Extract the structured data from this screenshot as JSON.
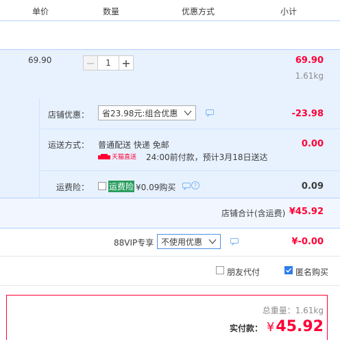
{
  "header": {
    "unit_price": "单价",
    "quantity": "数量",
    "discount_method": "优惠方式",
    "subtotal": "小计"
  },
  "item": {
    "unit_price": "69.90",
    "quantity": "1",
    "minus": "−",
    "plus": "+",
    "subtotal": "69.90",
    "weight": "1.61kg"
  },
  "shop": {
    "discount_label": "店铺优惠：",
    "discount_select": "省23.98元:组合优惠",
    "discount_amount": "-23.98",
    "shipping_label": "运送方式：",
    "shipping_method": "普通配送 快递 免邮",
    "tmall_direct": "天猫直送",
    "delivery_note": "24:00前付款，预计3月18日送达",
    "shipping_amount": "0.00",
    "insurance_label": "运费险：",
    "insurance_name": "运费险",
    "insurance_price": "¥0.09购买",
    "insurance_amount": "0.09",
    "total_label": "店铺合计(含运费)",
    "total_amount": "¥45.92"
  },
  "vip": {
    "label": "88VIP专享",
    "select": "不使用优惠",
    "amount": "¥-0.00"
  },
  "options": {
    "friend_pay": "朋友代付",
    "anonymous": "匿名购买",
    "friend_pay_checked": false,
    "anonymous_checked": true
  },
  "summary": {
    "total_weight": "总重量：1.61kg",
    "pay_label": "实付款：",
    "currency": "¥",
    "pay_amount": "45.92"
  },
  "colors": {
    "accent_red": "#ff0036",
    "row_blue": "#e8f2ff",
    "border_blue": "#b2d1ff",
    "check_blue": "#2b7cee"
  }
}
